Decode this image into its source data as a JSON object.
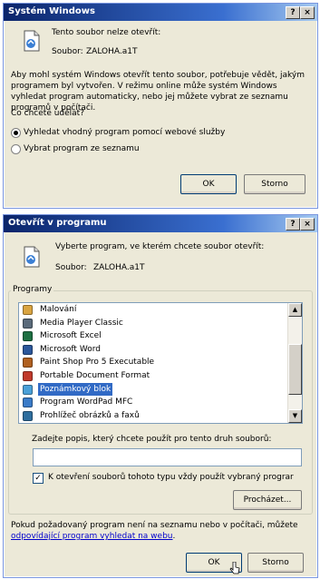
{
  "dialog1": {
    "title": "Systém Windows",
    "help_btn": "?",
    "close_btn": "×",
    "message": "Tento soubor nelze otevřít:",
    "file_label": "Soubor:",
    "file_name": "ZALOHA.a1T",
    "description": "Aby mohl systém Windows otevřít tento soubor, potřebuje vědět, jakým programem byl vytvořen. V režimu online může systém Windows vyhledat program automaticky, nebo jej můžete vybrat ze seznamu programů v počítači.",
    "question": "Co chcete udělat?",
    "options": [
      {
        "label": "Vyhledat vhodný program pomocí webové služby",
        "selected": true
      },
      {
        "label": "Vybrat program ze seznamu",
        "selected": false
      }
    ],
    "ok_label": "OK",
    "cancel_label": "Storno"
  },
  "dialog2": {
    "title": "Otevřít v programu",
    "help_btn": "?",
    "close_btn": "×",
    "instruction": "Vyberte program, ve kterém chcete soubor otevřít:",
    "file_label": "Soubor:",
    "file_name": "ZALOHA.a1T",
    "group_label": "Programy",
    "programs": [
      {
        "label": "Malování",
        "icon": "paint-icon",
        "color": "#d9a441"
      },
      {
        "label": "Media Player Classic",
        "icon": "media-player-icon",
        "color": "#5a6a7a"
      },
      {
        "label": "Microsoft Excel",
        "icon": "excel-icon",
        "color": "#1d6f42"
      },
      {
        "label": "Microsoft Word",
        "icon": "word-icon",
        "color": "#2b579a"
      },
      {
        "label": "Paint Shop Pro 5 Executable",
        "icon": "paint-shop-pro-icon",
        "color": "#b06020"
      },
      {
        "label": "Portable Document Format",
        "icon": "pdf-icon",
        "color": "#c0392b"
      },
      {
        "label": "Poznámkový blok",
        "icon": "notepad-icon",
        "color": "#4aa0d8"
      },
      {
        "label": "Program WordPad MFC",
        "icon": "wordpad-icon",
        "color": "#3a7bc8"
      },
      {
        "label": "Prohlížeč obrázků a faxů",
        "icon": "image-viewer-icon",
        "color": "#2f6e9e"
      }
    ],
    "selected_index": 6,
    "desc_label": "Zadejte popis, který chcete použít pro tento druh souborů:",
    "desc_value": "",
    "always_use_label": "K otevření souborů tohoto typu vždy použít vybraný prograr",
    "always_use_checked": true,
    "browse_label": "Procházet...",
    "footer_text": "Pokud požadovaný program není na seznamu nebo v počítači, můžete",
    "footer_link": "odpovídající program vyhledat na webu",
    "footer_end": ".",
    "ok_label": "OK",
    "cancel_label": "Storno"
  }
}
